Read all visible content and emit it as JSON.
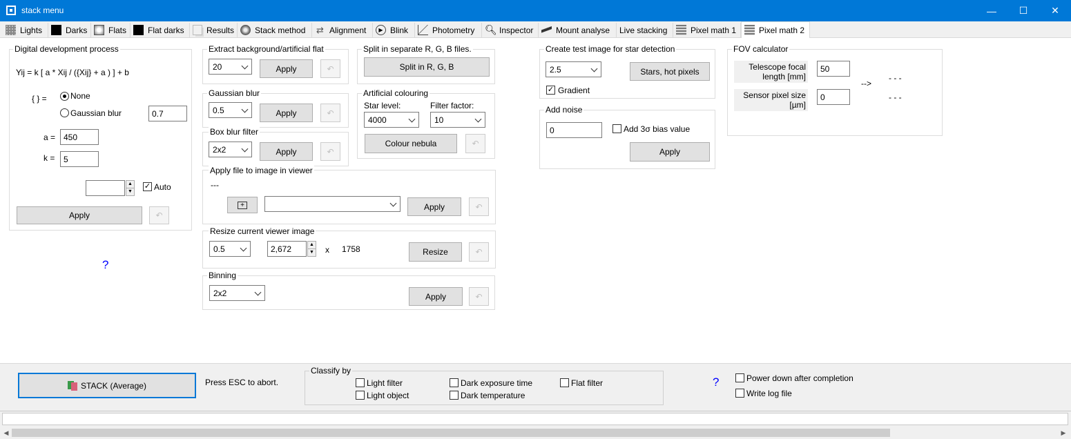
{
  "window": {
    "title": "stack menu",
    "controls": [
      "—",
      "☐",
      "✕"
    ]
  },
  "tabs": [
    {
      "label": "Lights"
    },
    {
      "label": "Darks"
    },
    {
      "label": "Flats"
    },
    {
      "label": "Flat darks"
    },
    {
      "label": "Results"
    },
    {
      "label": "Stack method"
    },
    {
      "label": "Alignment"
    },
    {
      "label": "Blink"
    },
    {
      "label": "Photometry"
    },
    {
      "label": "Inspector"
    },
    {
      "label": "Mount analyse"
    },
    {
      "label": "Live stacking"
    },
    {
      "label": "Pixel math 1"
    },
    {
      "label": "Pixel math 2"
    }
  ],
  "ddp": {
    "title": "Digital development process",
    "formula": "Yij = k [ a * Xij / ({Xij} + a ) ] + b",
    "brace_label": "{ } =",
    "radio_none": "None",
    "radio_gauss": "Gaussian blur",
    "gauss_value": "0.7",
    "a_label": "a =",
    "a_value": "450",
    "k_label": "k =",
    "k_value": "5",
    "auto_label": "Auto",
    "auto_checked": "✓",
    "apply": "Apply",
    "help": "?"
  },
  "extract_bg": {
    "title": "Extract background/artificial flat",
    "value": "20",
    "apply": "Apply"
  },
  "gaussian": {
    "title": "Gaussian blur",
    "value": "0.5",
    "apply": "Apply"
  },
  "boxblur": {
    "title": "Box blur filter",
    "value": "2x2",
    "apply": "Apply"
  },
  "split": {
    "title": "Split in separate R, G, B files.",
    "button": "Split in R, G, B"
  },
  "artcol": {
    "title": "Artificial colouring",
    "star_label": "Star level:",
    "star_value": "4000",
    "filter_label": "Filter factor:",
    "filter_value": "10",
    "button": "Colour nebula"
  },
  "applyfile": {
    "title": "Apply file to image in viewer",
    "status": "---",
    "file_value": "",
    "apply": "Apply"
  },
  "resize": {
    "title": "Resize current viewer image",
    "factor": "0.5",
    "width": "2,672",
    "x": "x",
    "height": "1758",
    "button": "Resize"
  },
  "binning": {
    "title": "Binning",
    "value": "2x2",
    "apply": "Apply"
  },
  "testimg": {
    "title": "Create test image for star detection",
    "value": "2.5",
    "button": "Stars, hot pixels",
    "gradient_label": "Gradient",
    "gradient_checked": "✓"
  },
  "noise": {
    "title": "Add noise",
    "value": "0",
    "bias_label": "Add 3σ bias value",
    "apply": "Apply"
  },
  "fov": {
    "title": "FOV calculator",
    "focal_label_1": "Telescope focal",
    "focal_label_2": "length [mm]",
    "focal_value": "50",
    "pixel_label_1": "Sensor pixel size",
    "pixel_label_2": "[µm]",
    "pixel_value": "0",
    "arrow": "-->",
    "result1": "- - -",
    "result2": "- - -"
  },
  "bottom": {
    "stack_button": "STACK  (Average)",
    "esc_text": "Press ESC to abort.",
    "classify_title": "Classify by",
    "light_filter": "Light filter",
    "light_object": "Light object",
    "dark_exposure": "Dark exposure time",
    "dark_temp": "Dark temperature",
    "flat_filter": "Flat filter",
    "help": "?",
    "power_down": "Power down after completion",
    "write_log": "Write log file"
  },
  "colors": {
    "titlebar": "#0078d7",
    "help": "#0000ff"
  }
}
